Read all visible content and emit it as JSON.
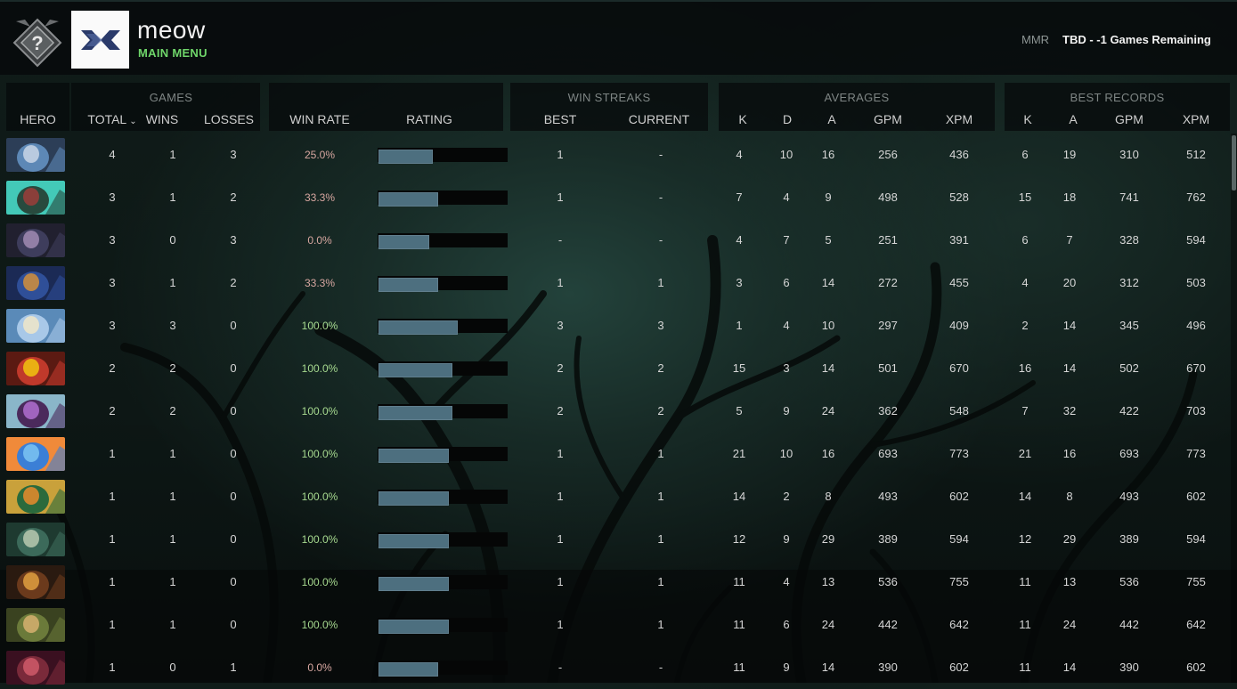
{
  "header": {
    "player_name": "meow",
    "subtitle": "MAIN MENU",
    "team_logo_text": "XX",
    "mmr_label": "MMR",
    "mmr_value": "TBD - -1 Games Remaining",
    "rank_badge_icon": "unknown-rank-icon",
    "accent_color": "#6fd66a"
  },
  "groups": {
    "games": "GAMES",
    "win_streaks": "WIN STREAKS",
    "averages": "AVERAGES",
    "best_records": "BEST RECORDS"
  },
  "columns": {
    "hero": "HERO",
    "total": "TOTAL",
    "wins": "WINS",
    "losses": "LOSSES",
    "win_rate": "WIN RATE",
    "rating": "RATING",
    "best": "BEST",
    "current": "CURRENT",
    "avg_k": "K",
    "avg_d": "D",
    "avg_a": "A",
    "avg_gpm": "GPM",
    "avg_xpm": "XPM",
    "best_k": "K",
    "best_a": "A",
    "best_gpm": "GPM",
    "best_xpm": "XPM"
  },
  "sort": {
    "column": "total",
    "icon": "chevron-down-icon"
  },
  "rows": [
    {
      "hero_colors": [
        "#5d88b6",
        "#c9d6e6",
        "#2c3e57"
      ],
      "total": "4",
      "wins": "1",
      "losses": "3",
      "win_rate": "25.0%",
      "rating": 0.42,
      "best": "1",
      "current": "-",
      "k": "4",
      "d": "10",
      "a": "16",
      "gpm": "256",
      "xpm": "436",
      "best_k": "6",
      "best_a": "19",
      "best_gpm": "310",
      "best_xpm": "512"
    },
    {
      "hero_colors": [
        "#284a3e",
        "#9b3d3a",
        "#43c9b8"
      ],
      "total": "3",
      "wins": "1",
      "losses": "2",
      "win_rate": "33.3%",
      "rating": 0.46,
      "best": "1",
      "current": "-",
      "k": "7",
      "d": "4",
      "a": "9",
      "gpm": "498",
      "xpm": "528",
      "best_k": "15",
      "best_a": "18",
      "best_gpm": "741",
      "best_xpm": "762"
    },
    {
      "hero_colors": [
        "#3e3d5c",
        "#a18bb3",
        "#21202f"
      ],
      "total": "3",
      "wins": "0",
      "losses": "3",
      "win_rate": "0.0%",
      "rating": 0.39,
      "best": "-",
      "current": "-",
      "k": "4",
      "d": "7",
      "a": "5",
      "gpm": "251",
      "xpm": "391",
      "best_k": "6",
      "best_a": "7",
      "best_gpm": "328",
      "best_xpm": "594"
    },
    {
      "hero_colors": [
        "#2f4f98",
        "#d28f3b",
        "#1b2a55"
      ],
      "total": "3",
      "wins": "1",
      "losses": "2",
      "win_rate": "33.3%",
      "rating": 0.46,
      "best": "1",
      "current": "1",
      "k": "3",
      "d": "6",
      "a": "14",
      "gpm": "272",
      "xpm": "455",
      "best_k": "4",
      "best_a": "20",
      "best_gpm": "312",
      "best_xpm": "503"
    },
    {
      "hero_colors": [
        "#a8c8e8",
        "#f0e6c8",
        "#5a8ab8"
      ],
      "total": "3",
      "wins": "3",
      "losses": "0",
      "win_rate": "100.0%",
      "rating": 0.61,
      "best": "3",
      "current": "3",
      "k": "1",
      "d": "4",
      "a": "10",
      "gpm": "297",
      "xpm": "409",
      "best_k": "2",
      "best_a": "14",
      "best_gpm": "345",
      "best_xpm": "496"
    },
    {
      "hero_colors": [
        "#c0392b",
        "#f1c40f",
        "#5b1a12"
      ],
      "total": "2",
      "wins": "2",
      "losses": "0",
      "win_rate": "100.0%",
      "rating": 0.57,
      "best": "2",
      "current": "2",
      "k": "15",
      "d": "3",
      "a": "14",
      "gpm": "501",
      "xpm": "670",
      "best_k": "16",
      "best_a": "14",
      "best_gpm": "502",
      "best_xpm": "670"
    },
    {
      "hero_colors": [
        "#4b2a5c",
        "#b06fd0",
        "#8ab6c9"
      ],
      "total": "2",
      "wins": "2",
      "losses": "0",
      "win_rate": "100.0%",
      "rating": 0.57,
      "best": "2",
      "current": "2",
      "k": "5",
      "d": "9",
      "a": "24",
      "gpm": "362",
      "xpm": "548",
      "best_k": "7",
      "best_a": "32",
      "best_gpm": "422",
      "best_xpm": "703"
    },
    {
      "hero_colors": [
        "#3b7fd6",
        "#7cc4f2",
        "#f08a3a"
      ],
      "total": "1",
      "wins": "1",
      "losses": "0",
      "win_rate": "100.0%",
      "rating": 0.54,
      "best": "1",
      "current": "1",
      "k": "21",
      "d": "10",
      "a": "16",
      "gpm": "693",
      "xpm": "773",
      "best_k": "21",
      "best_a": "16",
      "best_gpm": "693",
      "best_xpm": "773"
    },
    {
      "hero_colors": [
        "#2a6a3c",
        "#e88b2c",
        "#c9a13b"
      ],
      "total": "1",
      "wins": "1",
      "losses": "0",
      "win_rate": "100.0%",
      "rating": 0.54,
      "best": "1",
      "current": "1",
      "k": "14",
      "d": "2",
      "a": "8",
      "gpm": "493",
      "xpm": "602",
      "best_k": "14",
      "best_a": "8",
      "best_gpm": "493",
      "best_xpm": "602"
    },
    {
      "hero_colors": [
        "#3c6a5a",
        "#b9c9b0",
        "#1e3a30"
      ],
      "total": "1",
      "wins": "1",
      "losses": "0",
      "win_rate": "100.0%",
      "rating": 0.54,
      "best": "1",
      "current": "1",
      "k": "12",
      "d": "9",
      "a": "29",
      "gpm": "389",
      "xpm": "594",
      "best_k": "12",
      "best_a": "29",
      "best_gpm": "389",
      "best_xpm": "594"
    },
    {
      "hero_colors": [
        "#6b3a1c",
        "#e0a040",
        "#2a1a10"
      ],
      "total": "1",
      "wins": "1",
      "losses": "0",
      "win_rate": "100.0%",
      "rating": 0.54,
      "best": "1",
      "current": "1",
      "k": "11",
      "d": "4",
      "a": "13",
      "gpm": "536",
      "xpm": "755",
      "best_k": "11",
      "best_a": "13",
      "best_gpm": "536",
      "best_xpm": "755"
    },
    {
      "hero_colors": [
        "#6b7a3a",
        "#d6b070",
        "#3a4220"
      ],
      "total": "1",
      "wins": "1",
      "losses": "0",
      "win_rate": "100.0%",
      "rating": 0.54,
      "best": "1",
      "current": "1",
      "k": "11",
      "d": "6",
      "a": "24",
      "gpm": "442",
      "xpm": "642",
      "best_k": "11",
      "best_a": "24",
      "best_gpm": "442",
      "best_xpm": "642"
    },
    {
      "hero_colors": [
        "#7a2a3a",
        "#d05a6a",
        "#3a1020"
      ],
      "total": "1",
      "wins": "0",
      "losses": "1",
      "win_rate": "0.0%",
      "rating": 0.46,
      "best": "-",
      "current": "-",
      "k": "11",
      "d": "9",
      "a": "14",
      "gpm": "390",
      "xpm": "602",
      "best_k": "11",
      "best_a": "14",
      "best_gpm": "390",
      "best_xpm": "602"
    }
  ]
}
